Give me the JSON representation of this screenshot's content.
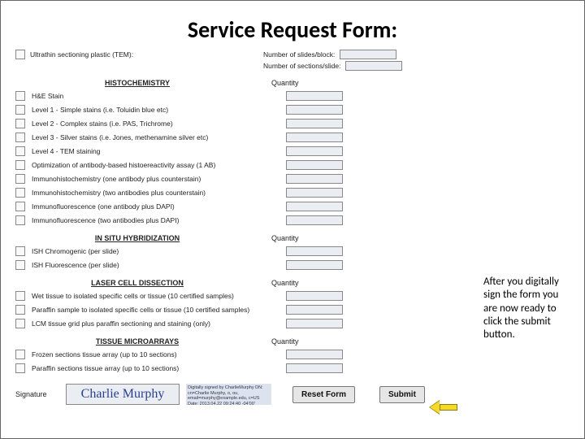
{
  "title": "Service Request Form:",
  "top": {
    "left_label": "Ultrathin sectioning plastic (TEM):",
    "r1": "Number of slides/block:",
    "r2": "Number of sections/slide:"
  },
  "sections": [
    {
      "name": "HISTOCHEMISTRY",
      "qty": "Quantity",
      "items": [
        "H&E Stain",
        "Level 1 - Simple stains (i.e. Toluidin blue etc)",
        "Level 2 - Complex stains (i.e. PAS, Trichrome)",
        "Level 3 - Silver stains (i.e. Jones, methenamine silver etc)",
        "Level 4 - TEM staining",
        "Optimization of antibody-based histoereactivity assay (1 AB)",
        "Immunohistochemistry (one antibody plus counterstain)",
        "Immunohistochemistry (two antibodies plus counterstain)",
        "Immunofluorescence (one antibody plus DAPI)",
        "Immunofluorescence (two antibodies plus DAPI)"
      ]
    },
    {
      "name": "IN SITU HYBRIDIZATION",
      "qty": "Quantity",
      "items": [
        "ISH Chromogenic (per slide)",
        "ISH Fluorescence (per slide)"
      ]
    },
    {
      "name": "LASER CELL DISSECTION",
      "qty": "Quantity",
      "items": [
        "Wet tissue to isolated specific cells or tissue (10 certified samples)",
        "Paraffin sample to isolated specific cells or tissue (10 certified samples)",
        "LCM tissue grid plus paraffin sectioning and staining (only)"
      ]
    },
    {
      "name": "TISSUE MICROARRAYS",
      "qty": "Quantity",
      "items": [
        "Frozen sections tissue array (up to 10 sections)",
        "Paraffin sections tissue array (up to 10 sections)"
      ]
    }
  ],
  "signature": {
    "label": "Signature",
    "value": "Charlie Murphy",
    "stamp": "Digitally signed by CharlieMurphy\nDN: cn=Charlie Murphy, o, ou,\nemail=murphy@example.edu, c=US\nDate: 2013.04.22 09:24:40 -04'00'"
  },
  "buttons": {
    "reset": "Reset Form",
    "submit": "Submit"
  },
  "callout": "After you digitally sign the form you are now ready to click the submit button."
}
